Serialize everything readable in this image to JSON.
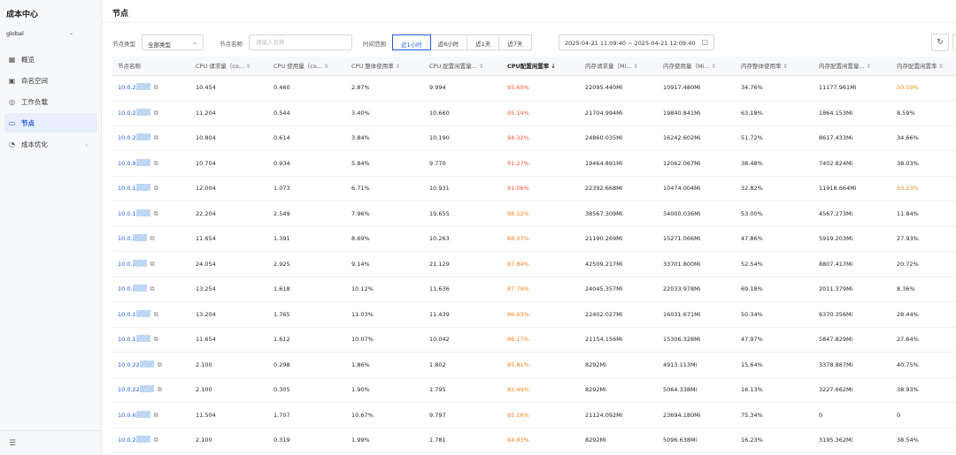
{
  "app": {
    "title": "成本中心",
    "region": "global",
    "region_caret": "⌄"
  },
  "sidebar": {
    "items": [
      {
        "label": "概览",
        "icon": "dashboard-icon",
        "glyph": "▦"
      },
      {
        "label": "命名空间",
        "icon": "namespace-icon",
        "glyph": "▣"
      },
      {
        "label": "工作负载",
        "icon": "workload-icon",
        "glyph": "◎"
      },
      {
        "label": "节点",
        "icon": "node-icon",
        "glyph": "▭",
        "active": true
      },
      {
        "label": "成本优化",
        "icon": "optimization-icon",
        "glyph": "◔",
        "has_submenu": true
      }
    ],
    "collapse_glyph": "☰"
  },
  "header": {
    "title": "节点"
  },
  "filters": {
    "type_label": "节点类型",
    "type_value": "全部类型",
    "name_label": "节点名称",
    "name_placeholder": "请输入名称",
    "time_label": "时间范围",
    "time_tabs": [
      "近1小时",
      "近6小时",
      "近1天",
      "近7天"
    ],
    "active_tab": 0,
    "date_range": "2025-04-21 11:09:40 ~ 2025-04-21 12:09:40",
    "calendar_glyph": "▢",
    "refresh_glyph": "↻"
  },
  "table": {
    "columns": [
      {
        "label": "节点名称",
        "sortable": false
      },
      {
        "label": "CPU 请求量（co...",
        "sortable": true
      },
      {
        "label": "CPU 使用量（co...",
        "sortable": true
      },
      {
        "label": "CPU 整体使用率",
        "sortable": true
      },
      {
        "label": "CPU 配置闲置量...",
        "sortable": true
      },
      {
        "label": "CPU配置闲置率",
        "sortable": true,
        "sorted": "desc"
      },
      {
        "label": "内存请求量（Mi...",
        "sortable": true
      },
      {
        "label": "内存使用量（Mi...",
        "sortable": true
      },
      {
        "label": "内存整体使用率",
        "sortable": true
      },
      {
        "label": "内存配置闲置量...",
        "sortable": true
      },
      {
        "label": "内存配置闲置率",
        "sortable": true
      }
    ],
    "sort_glyph": "⇕",
    "sort_desc_glyph": "↓",
    "copy_glyph": "⧉",
    "rows": [
      {
        "name": "10.0.2",
        "cpu_req": "10.454",
        "cpu_used": "0.460",
        "cpu_util": "2.87%",
        "cpu_idle": "9.994",
        "cpu_idle_rate": "95.60%",
        "cpu_idle_color": "red",
        "mem_req": "22095.440Mi",
        "mem_used": "10917.480Mi",
        "mem_util": "34.76%",
        "mem_idle": "11177.961Mi",
        "mem_idle_rate": "50.59%",
        "mem_idle_color": "orange"
      },
      {
        "name": "10.0.2",
        "cpu_req": "11.204",
        "cpu_used": "0.544",
        "cpu_util": "3.40%",
        "cpu_idle": "10.660",
        "cpu_idle_rate": "95.14%",
        "cpu_idle_color": "red",
        "mem_req": "21704.994Mi",
        "mem_used": "19840.841Mi",
        "mem_util": "63.18%",
        "mem_idle": "1864.153Mi",
        "mem_idle_rate": "8.59%",
        "mem_idle_color": ""
      },
      {
        "name": "10.0.2",
        "cpu_req": "10.804",
        "cpu_used": "0.614",
        "cpu_util": "3.84%",
        "cpu_idle": "10.190",
        "cpu_idle_rate": "94.32%",
        "cpu_idle_color": "red",
        "mem_req": "24860.035Mi",
        "mem_used": "16242.602Mi",
        "mem_util": "51.72%",
        "mem_idle": "8617.433Mi",
        "mem_idle_rate": "34.66%",
        "mem_idle_color": ""
      },
      {
        "name": "10.0.9",
        "cpu_req": "10.704",
        "cpu_used": "0.934",
        "cpu_util": "5.84%",
        "cpu_idle": "9.770",
        "cpu_idle_rate": "91.27%",
        "cpu_idle_color": "red",
        "mem_req": "19464.891Mi",
        "mem_used": "12062.067Mi",
        "mem_util": "38.48%",
        "mem_idle": "7402.824Mi",
        "mem_idle_rate": "38.03%",
        "mem_idle_color": ""
      },
      {
        "name": "10.0.1",
        "cpu_req": "12.004",
        "cpu_used": "1.073",
        "cpu_util": "6.71%",
        "cpu_idle": "10.931",
        "cpu_idle_rate": "91.06%",
        "cpu_idle_color": "red",
        "mem_req": "22392.668Mi",
        "mem_used": "10474.004Mi",
        "mem_util": "32.82%",
        "mem_idle": "11918.664Mi",
        "mem_idle_rate": "53.23%",
        "mem_idle_color": "orange"
      },
      {
        "name": "10.0.1",
        "cpu_req": "22.204",
        "cpu_used": "2.549",
        "cpu_util": "7.96%",
        "cpu_idle": "19.655",
        "cpu_idle_rate": "88.52%",
        "cpu_idle_color": "orange",
        "mem_req": "38567.309Mi",
        "mem_used": "34000.036Mi",
        "mem_util": "53.00%",
        "mem_idle": "4567.273Mi",
        "mem_idle_rate": "11.84%",
        "mem_idle_color": ""
      },
      {
        "name": "10.0.",
        "cpu_req": "11.654",
        "cpu_used": "1.391",
        "cpu_util": "8.69%",
        "cpu_idle": "10.263",
        "cpu_idle_rate": "88.07%",
        "cpu_idle_color": "orange",
        "mem_req": "21190.269Mi",
        "mem_used": "15271.066Mi",
        "mem_util": "47.86%",
        "mem_idle": "5919.203Mi",
        "mem_idle_rate": "27.93%",
        "mem_idle_color": ""
      },
      {
        "name": "10.0.",
        "cpu_req": "24.054",
        "cpu_used": "2.925",
        "cpu_util": "9.14%",
        "cpu_idle": "21.129",
        "cpu_idle_rate": "87.84%",
        "cpu_idle_color": "orange",
        "mem_req": "42509.217Mi",
        "mem_used": "33701.800Mi",
        "mem_util": "52.54%",
        "mem_idle": "8807.417Mi",
        "mem_idle_rate": "20.72%",
        "mem_idle_color": ""
      },
      {
        "name": "10.0.",
        "cpu_req": "13.254",
        "cpu_used": "1.618",
        "cpu_util": "10.12%",
        "cpu_idle": "11.636",
        "cpu_idle_rate": "87.79%",
        "cpu_idle_color": "orange",
        "mem_req": "24045.357Mi",
        "mem_used": "22033.978Mi",
        "mem_util": "69.18%",
        "mem_idle": "2011.379Mi",
        "mem_idle_rate": "8.36%",
        "mem_idle_color": ""
      },
      {
        "name": "10.0.1",
        "cpu_req": "13.204",
        "cpu_used": "1.765",
        "cpu_util": "11.03%",
        "cpu_idle": "11.439",
        "cpu_idle_rate": "86.63%",
        "cpu_idle_color": "orange",
        "mem_req": "22402.027Mi",
        "mem_used": "16031.671Mi",
        "mem_util": "50.34%",
        "mem_idle": "6370.356Mi",
        "mem_idle_rate": "28.44%",
        "mem_idle_color": ""
      },
      {
        "name": "10.0.1",
        "cpu_req": "11.654",
        "cpu_used": "1.612",
        "cpu_util": "10.07%",
        "cpu_idle": "10.042",
        "cpu_idle_rate": "86.17%",
        "cpu_idle_color": "orange",
        "mem_req": "21154.156Mi",
        "mem_used": "15306.328Mi",
        "mem_util": "47.97%",
        "mem_idle": "5847.829Mi",
        "mem_idle_rate": "27.64%",
        "mem_idle_color": ""
      },
      {
        "name": "10.0.22",
        "cpu_req": "2.100",
        "cpu_used": "0.298",
        "cpu_util": "1.86%",
        "cpu_idle": "1.802",
        "cpu_idle_rate": "85.81%",
        "cpu_idle_color": "orange",
        "mem_req": "8292Mi",
        "mem_used": "4913.113Mi",
        "mem_util": "15.64%",
        "mem_idle": "3378.887Mi",
        "mem_idle_rate": "40.75%",
        "mem_idle_color": ""
      },
      {
        "name": "10.0.22",
        "cpu_req": "2.100",
        "cpu_used": "0.305",
        "cpu_util": "1.90%",
        "cpu_idle": "1.795",
        "cpu_idle_rate": "85.49%",
        "cpu_idle_color": "orange",
        "mem_req": "8292Mi",
        "mem_used": "5064.338Mi",
        "mem_util": "16.13%",
        "mem_idle": "3227.662Mi",
        "mem_idle_rate": "38.93%",
        "mem_idle_color": ""
      },
      {
        "name": "10.0.6",
        "cpu_req": "11.504",
        "cpu_used": "1.707",
        "cpu_util": "10.67%",
        "cpu_idle": "9.797",
        "cpu_idle_rate": "85.16%",
        "cpu_idle_color": "orange",
        "mem_req": "21124.092Mi",
        "mem_used": "23694.180Mi",
        "mem_util": "75.34%",
        "mem_idle": "0",
        "mem_idle_rate": "0",
        "mem_idle_color": ""
      },
      {
        "name": "10.0.2",
        "cpu_req": "2.100",
        "cpu_used": "0.319",
        "cpu_util": "1.99%",
        "cpu_idle": "1.781",
        "cpu_idle_rate": "84.83%",
        "cpu_idle_color": "orange",
        "mem_req": "8292Mi",
        "mem_used": "5096.638Mi",
        "mem_util": "16.23%",
        "mem_idle": "3195.362Mi",
        "mem_idle_rate": "38.54%",
        "mem_idle_color": ""
      }
    ]
  },
  "colors": {
    "accent": "#1f5be0",
    "high_idle": "#f0533b",
    "mid_idle": "#f5841b"
  }
}
